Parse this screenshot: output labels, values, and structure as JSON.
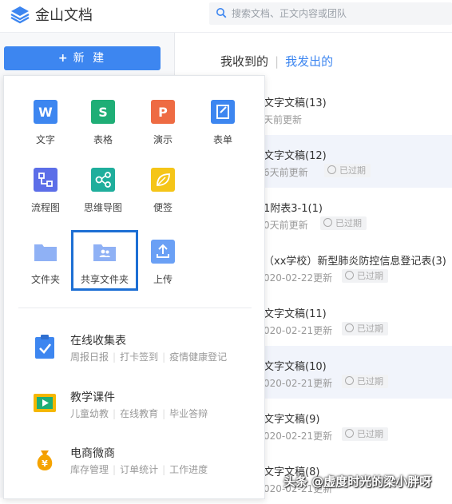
{
  "app": {
    "title": "金山文档",
    "search_placeholder": "搜索文档、正文内容或团队",
    "brand_color": "#3d86f0"
  },
  "sidebar": {
    "new_button_label": "新 建"
  },
  "tabs": {
    "received": "我收到的",
    "separator": "|",
    "sent": "我发出的"
  },
  "new_menu": {
    "grid": [
      {
        "label": "文字",
        "icon": "doc-w-icon",
        "color": "#3d86f0"
      },
      {
        "label": "表格",
        "icon": "sheet-s-icon",
        "color": "#1fae76"
      },
      {
        "label": "演示",
        "icon": "slides-p-icon",
        "color": "#ee6b43"
      },
      {
        "label": "表单",
        "icon": "form-icon",
        "color": "#3d86f0"
      },
      {
        "label": "流程图",
        "icon": "flowchart-icon",
        "color": "#5c6ee8"
      },
      {
        "label": "思维导图",
        "icon": "mindmap-icon",
        "color": "#1fae9c"
      },
      {
        "label": "便签",
        "icon": "note-leaf-icon",
        "color": "#f5c518"
      },
      {
        "label": "文件夹",
        "icon": "folder-icon",
        "color": "#8fb1f5"
      },
      {
        "label": "共享文件夹",
        "icon": "shared-folder-icon",
        "color": "#8fb1f5"
      },
      {
        "label": "上传",
        "icon": "upload-icon",
        "color": "#6aa0f5"
      }
    ],
    "features": [
      {
        "title": "在线收集表",
        "icon": "clipboard-check-icon",
        "subs": [
          "周报日报",
          "打卡签到",
          "疫情健康登记"
        ]
      },
      {
        "title": "教学课件",
        "icon": "play-courseware-icon",
        "subs": [
          "儿童幼教",
          "在线教育",
          "毕业答辩"
        ]
      },
      {
        "title": "电商微商",
        "icon": "money-bag-icon",
        "subs": [
          "库存管理",
          "订单统计",
          "工作进度"
        ]
      }
    ]
  },
  "files": [
    {
      "name": "文字文稿(13)",
      "meta": "天前更新",
      "badge": ""
    },
    {
      "name": "文字文稿(12)",
      "meta": "6天前更新",
      "badge": "已过期"
    },
    {
      "name": "1附表3-1(1)",
      "meta": "0天前更新",
      "badge": "已过期"
    },
    {
      "name": "（xx学校）新型肺炎防控信息登记表(3)",
      "meta": "020-02-22更新",
      "badge": "已过期"
    },
    {
      "name": "文字文稿(11)",
      "meta": "020-02-21更新",
      "badge": "已过期"
    },
    {
      "name": "文字文稿(10)",
      "meta": "020-02-21更新",
      "badge": "已过期"
    },
    {
      "name": "文字文稿(9)",
      "meta": "020-02-21更新",
      "badge": "已过期"
    },
    {
      "name": "文字文稿(8)",
      "meta": "020-02-21更新",
      "badge": ""
    }
  ],
  "watermark": "头条 @虚度时光的梁小胖呀"
}
